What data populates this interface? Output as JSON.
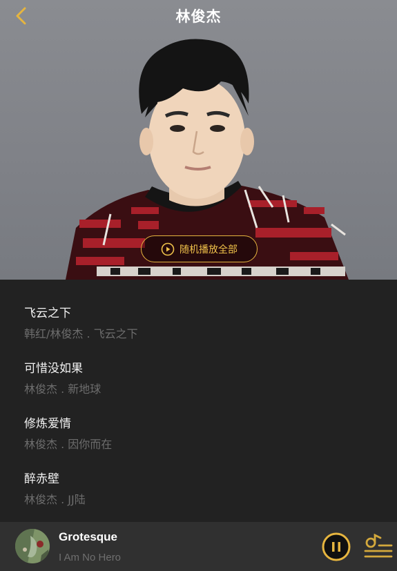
{
  "header": {
    "title": "林俊杰",
    "back_icon": "chevron-left-icon"
  },
  "hero": {
    "shuffle_label": "随机播放全部",
    "shuffle_icon": "play-circle-icon",
    "accent_color": "#e6b53f"
  },
  "songs": [
    {
      "title": "飞云之下",
      "meta": "韩红/林俊杰 . 飞云之下"
    },
    {
      "title": "可惜没如果",
      "meta": "林俊杰 . 新地球"
    },
    {
      "title": "修炼爱情",
      "meta": "林俊杰 . 因你而在"
    },
    {
      "title": "醉赤壁",
      "meta": "林俊杰 . JJ陆"
    }
  ],
  "now_playing": {
    "title": "Grotesque",
    "artist": "I Am No Hero",
    "state_icon": "pause-icon",
    "playlist_icon": "playlist-icon"
  }
}
